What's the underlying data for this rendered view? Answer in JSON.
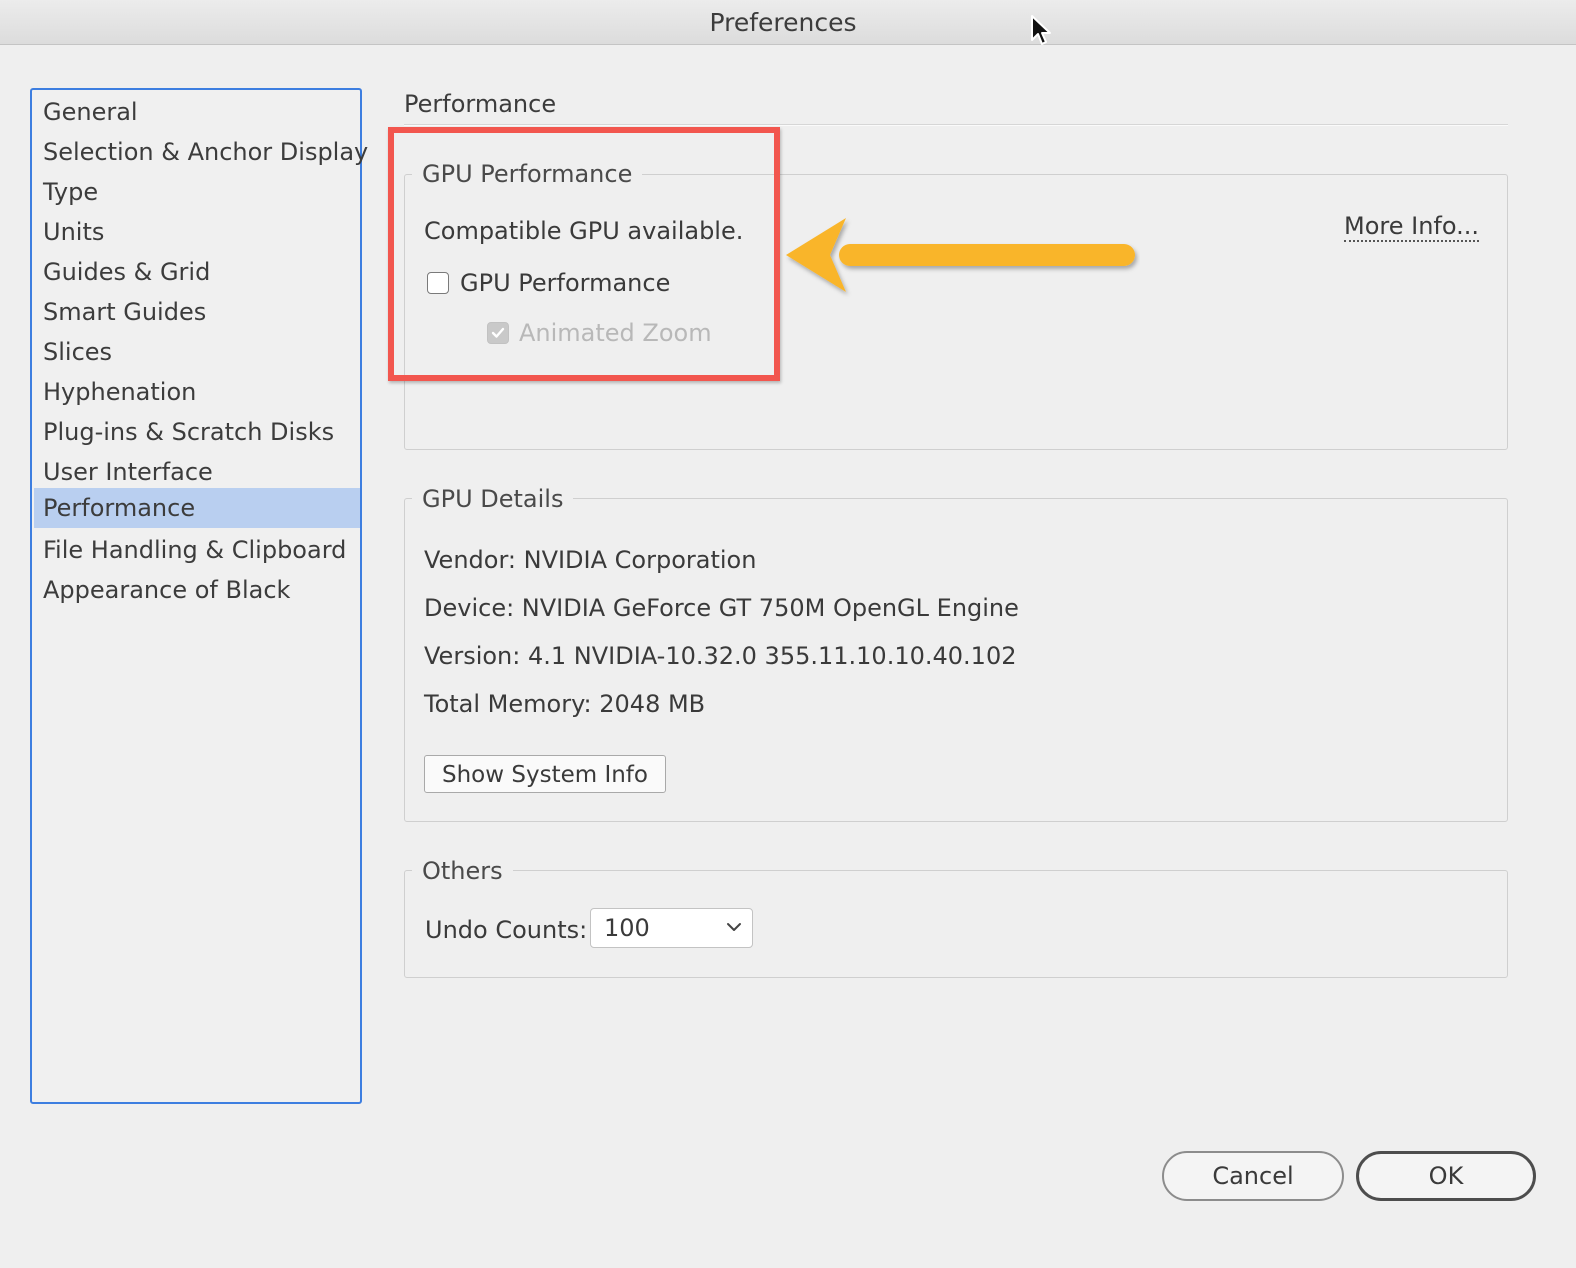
{
  "window": {
    "title": "Preferences"
  },
  "sidebar": {
    "items": [
      {
        "label": "General"
      },
      {
        "label": "Selection & Anchor Display"
      },
      {
        "label": "Type"
      },
      {
        "label": "Units"
      },
      {
        "label": "Guides & Grid"
      },
      {
        "label": "Smart Guides"
      },
      {
        "label": "Slices"
      },
      {
        "label": "Hyphenation"
      },
      {
        "label": "Plug-ins & Scratch Disks"
      },
      {
        "label": "User Interface"
      },
      {
        "label": "Performance",
        "selected": true
      },
      {
        "label": "File Handling & Clipboard"
      },
      {
        "label": "Appearance of Black"
      }
    ]
  },
  "main": {
    "heading": "Performance",
    "gpu_performance": {
      "title": "GPU Performance",
      "status": "Compatible GPU available.",
      "more_info": "More Info...",
      "gpu_checkbox": {
        "label": "GPU Performance",
        "checked": false
      },
      "animated_zoom": {
        "label": "Animated Zoom",
        "checked": true,
        "disabled": true
      }
    },
    "gpu_details": {
      "title": "GPU Details",
      "vendor": "Vendor: NVIDIA Corporation",
      "device": "Device: NVIDIA GeForce GT 750M OpenGL Engine",
      "version": "Version: 4.1 NVIDIA-10.32.0 355.11.10.10.40.102",
      "memory": "Total Memory: 2048 MB",
      "show_system_info": "Show System Info"
    },
    "others": {
      "title": "Others",
      "undo_label": "Undo Counts:",
      "undo_value": "100"
    }
  },
  "footer": {
    "cancel": "Cancel",
    "ok": "OK"
  },
  "annotations": {
    "highlight_color": "#f2564e",
    "arrow_color": "#f9b52a"
  }
}
